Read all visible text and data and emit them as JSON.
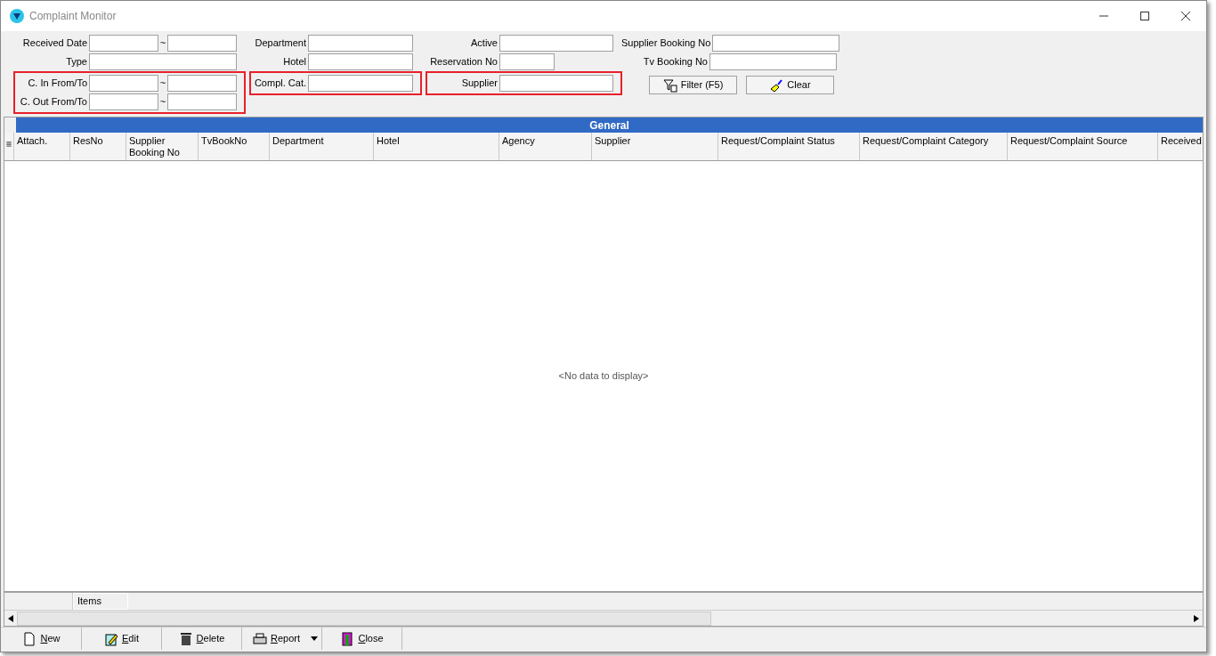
{
  "window": {
    "title": "Complaint Monitor"
  },
  "filters": [
    {
      "rows": [
        {
          "label": "Received Date",
          "kind": "range",
          "highlighted": false
        },
        {
          "label": "Type",
          "kind": "text",
          "highlighted": false
        },
        {
          "label": "C. In From/To",
          "kind": "range",
          "highlighted": true
        },
        {
          "label": "C. Out From/To",
          "kind": "range",
          "highlighted": true
        }
      ]
    },
    {
      "rows": [
        {
          "label": "Department",
          "kind": "text",
          "highlighted": false
        },
        {
          "label": "Hotel",
          "kind": "text",
          "highlighted": false
        },
        {
          "label": "Compl. Cat.",
          "kind": "text",
          "highlighted": true
        }
      ]
    },
    {
      "rows": [
        {
          "label": "Active",
          "kind": "text",
          "highlighted": false
        },
        {
          "label": "Reservation No",
          "kind": "short",
          "highlighted": false
        },
        {
          "label": "Supplier",
          "kind": "text",
          "highlighted": true
        }
      ]
    },
    {
      "rows": [
        {
          "label": "Supplier Booking No",
          "kind": "text",
          "highlighted": false
        },
        {
          "label": "Tv Booking No",
          "kind": "text",
          "highlighted": false
        }
      ]
    }
  ],
  "range_separator": "~",
  "filter_buttons": [
    {
      "label": "Filter (F5)",
      "kind": "filter"
    },
    {
      "label": "Clear",
      "kind": "clear"
    }
  ],
  "table": {
    "band": "General",
    "columns": [
      "Attach.",
      "ResNo",
      "Supplier Booking No",
      "TvBookNo",
      "Department",
      "Hotel",
      "Agency",
      "Supplier",
      "Request/Complaint Status",
      "Request/Complaint Category",
      "Request/Complaint Source",
      "Received"
    ],
    "empty_text": "<No data to display>",
    "footer": "Items"
  },
  "actions": [
    {
      "label": "New",
      "kind": "new",
      "dropdown": false
    },
    {
      "label": "Edit",
      "kind": "edit",
      "dropdown": false
    },
    {
      "label": "Delete",
      "kind": "delete",
      "dropdown": false
    },
    {
      "label": "Report",
      "kind": "report",
      "dropdown": true
    },
    {
      "label": "Close",
      "kind": "close",
      "dropdown": false
    }
  ]
}
